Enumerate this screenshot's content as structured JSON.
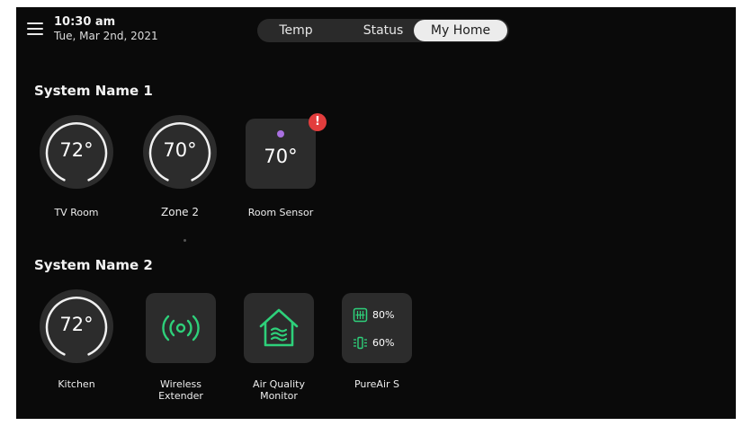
{
  "header": {
    "time": "10:30 am",
    "date": "Tue, Mar 2nd, 2021",
    "menu_icon": "hamburger-menu-icon"
  },
  "tabs": [
    {
      "label": "Temp",
      "active": false
    },
    {
      "label": "Status",
      "active": false
    },
    {
      "label": "My Home",
      "active": true
    }
  ],
  "systems": [
    {
      "name": "System Name 1",
      "devices": [
        {
          "type": "thermostat",
          "value": "72°",
          "label": "TV Room"
        },
        {
          "type": "thermostat",
          "value": "70°",
          "label": "Zone 2"
        },
        {
          "type": "sensor",
          "value": "70°",
          "label": "Room Sensor",
          "alert": "!"
        }
      ]
    },
    {
      "name": "System Name 2",
      "devices": [
        {
          "type": "thermostat",
          "value": "72°",
          "label": "Kitchen"
        },
        {
          "type": "wireless-extender",
          "icon": "wireless-signal-icon",
          "label_line1": "Wireless",
          "label_line2": "Extender"
        },
        {
          "type": "air-quality",
          "icon": "air-quality-house-icon",
          "label_line1": "Air Quality",
          "label_line2": "Monitor"
        },
        {
          "type": "purifier",
          "label": "PureAir S",
          "filter_value": "80%",
          "filter_icon": "filter-icon",
          "uv_value": "60%",
          "uv_icon": "uv-lamp-icon"
        }
      ]
    }
  ],
  "colors": {
    "background": "#0a0a0a",
    "tile": "#2c2c2c",
    "accent_green": "#2ed07a",
    "sensor_dot": "#a970e0",
    "alert": "#e23d3d"
  }
}
